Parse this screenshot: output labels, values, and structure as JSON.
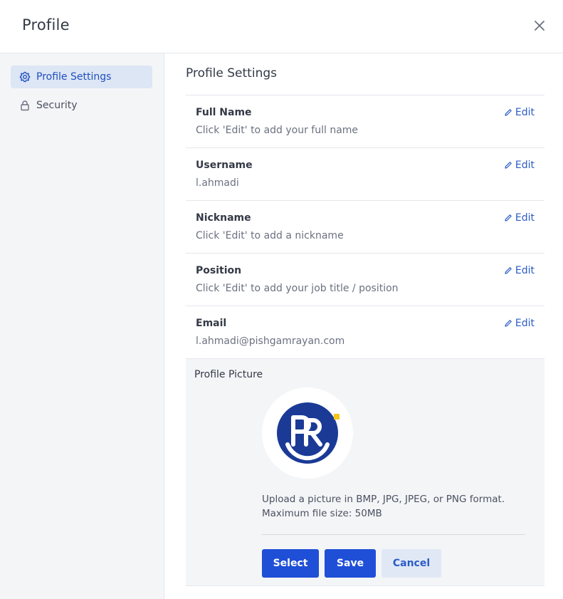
{
  "header": {
    "title": "Profile"
  },
  "sidebar": {
    "items": [
      {
        "label": "Profile Settings",
        "icon": "gear-icon",
        "active": true
      },
      {
        "label": "Security",
        "icon": "lock-icon",
        "active": false
      }
    ]
  },
  "main": {
    "section_title": "Profile Settings",
    "edit_label": "Edit",
    "fields": [
      {
        "label": "Full Name",
        "value": "Click 'Edit' to add your full name"
      },
      {
        "label": "Username",
        "value": "l.ahmadi"
      },
      {
        "label": "Nickname",
        "value": "Click 'Edit' to add a nickname"
      },
      {
        "label": "Position",
        "value": "Click 'Edit' to add your job title / position"
      },
      {
        "label": "Email",
        "value": "l.ahmadi@pishgamrayan.com"
      }
    ],
    "picture": {
      "label": "Profile Picture",
      "hint_line1": "Upload a picture in BMP, JPG, JPEG, or PNG format.",
      "hint_line2": "Maximum file size: 50MB",
      "buttons": {
        "select": "Select",
        "save": "Save",
        "cancel": "Cancel"
      }
    }
  },
  "colors": {
    "accent": "#1f4fd6",
    "link": "#2b5cc7",
    "logo_blue": "#1a3a96",
    "logo_yellow": "#f5c518"
  }
}
